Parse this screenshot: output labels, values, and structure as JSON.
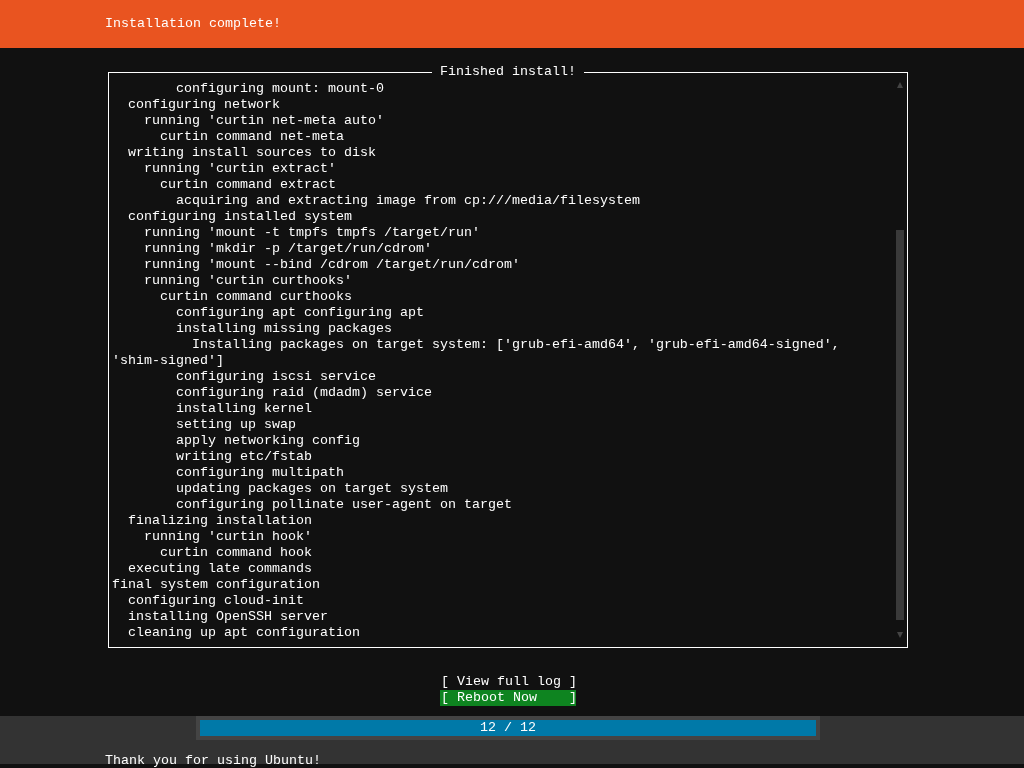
{
  "header": {
    "title": "Installation complete!"
  },
  "log_frame": {
    "title": "Finished install!",
    "lines": [
      "        configuring mount: mount-0",
      "  configuring network",
      "    running 'curtin net-meta auto'",
      "      curtin command net-meta",
      "  writing install sources to disk",
      "    running 'curtin extract'",
      "      curtin command extract",
      "        acquiring and extracting image from cp:///media/filesystem",
      "  configuring installed system",
      "    running 'mount -t tmpfs tmpfs /target/run'",
      "    running 'mkdir -p /target/run/cdrom'",
      "    running 'mount --bind /cdrom /target/run/cdrom'",
      "    running 'curtin curthooks'",
      "      curtin command curthooks",
      "        configuring apt configuring apt",
      "        installing missing packages",
      "          Installing packages on target system: ['grub-efi-amd64', 'grub-efi-amd64-signed', 'shim-signed']",
      "        configuring iscsi service",
      "        configuring raid (mdadm) service",
      "        installing kernel",
      "        setting up swap",
      "        apply networking config",
      "        writing etc/fstab",
      "        configuring multipath",
      "        updating packages on target system",
      "        configuring pollinate user-agent on target",
      "  finalizing installation",
      "    running 'curtin hook'",
      "      curtin command hook",
      "  executing late commands",
      "final system configuration",
      "  configuring cloud-init",
      "  installing OpenSSH server",
      "  cleaning up apt configuration"
    ]
  },
  "buttons": [
    {
      "label": "[ View full log ]",
      "selected": false
    },
    {
      "label": "[ Reboot Now    ]",
      "selected": true
    }
  ],
  "progress": {
    "level": 1,
    "reading": "12 / 12"
  },
  "footer": {
    "text": "Thank you for using Ubuntu!"
  }
}
